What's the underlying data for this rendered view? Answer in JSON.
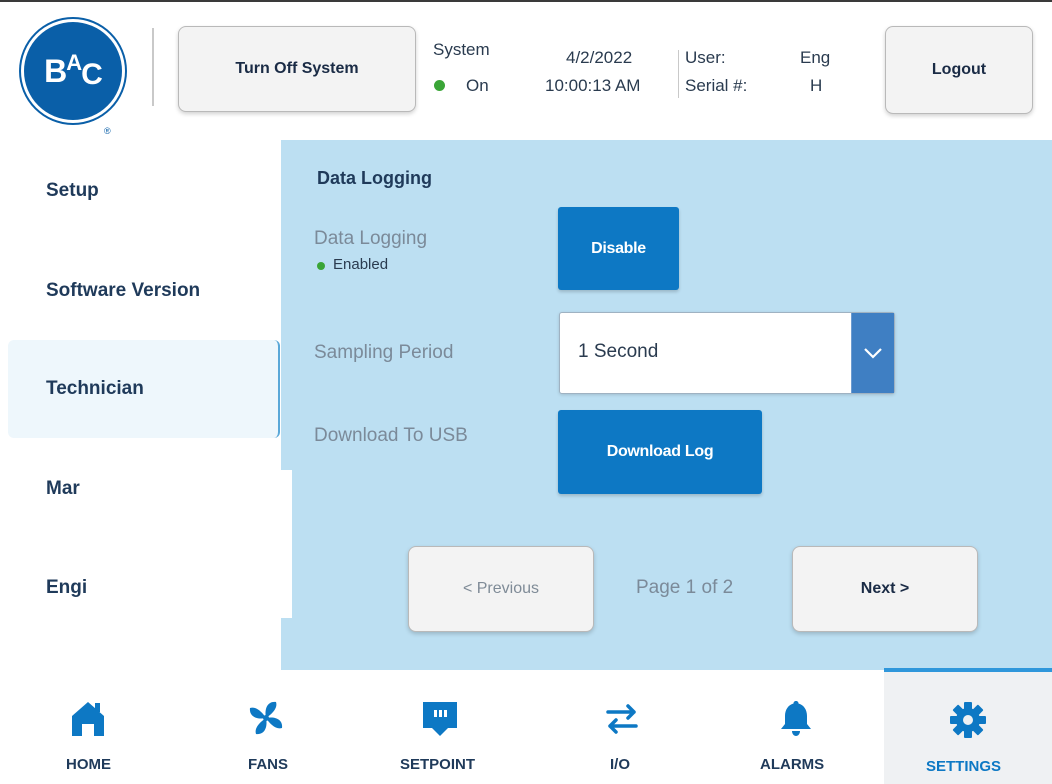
{
  "header": {
    "turn_off_label": "Turn Off System",
    "system_label": "System",
    "system_status": "On",
    "date": "4/2/2022",
    "time": "10:00:13 AM",
    "user_label": "User:",
    "user_value": "Eng",
    "serial_label": "Serial #:",
    "serial_value": "H",
    "logout_label": "Logout",
    "logo_letters": [
      "B",
      "A",
      "C"
    ],
    "logo_reg": "®",
    "status_color": "#3aa537"
  },
  "sidebar": {
    "items": [
      {
        "label": "Setup"
      },
      {
        "label": "Software Version"
      },
      {
        "label": "Technician"
      },
      {
        "label": "Mar"
      },
      {
        "label": "Engi"
      }
    ],
    "active": "Technician"
  },
  "main": {
    "title": "Data Logging",
    "data_logging_label": "Data Logging",
    "data_logging_status": "Enabled",
    "disable_label": "Disable",
    "sampling_label": "Sampling Period",
    "sampling_value": "1 Second",
    "download_label": "Download To USB",
    "download_button": "Download Log",
    "prev_label": "< Previous",
    "next_label": "Next >",
    "page_indicator": "Page 1 of 2",
    "accent_color": "#0d78c4"
  },
  "nav": {
    "items": [
      {
        "label": "HOME",
        "icon": "home-icon"
      },
      {
        "label": "FANS",
        "icon": "fan-icon"
      },
      {
        "label": "SETPOINT",
        "icon": "setpoint-icon"
      },
      {
        "label": "I/O",
        "icon": "io-arrows-icon"
      },
      {
        "label": "ALARMS",
        "icon": "bell-icon"
      },
      {
        "label": "SETTINGS",
        "icon": "gear-icon"
      }
    ],
    "active": "SETTINGS"
  }
}
